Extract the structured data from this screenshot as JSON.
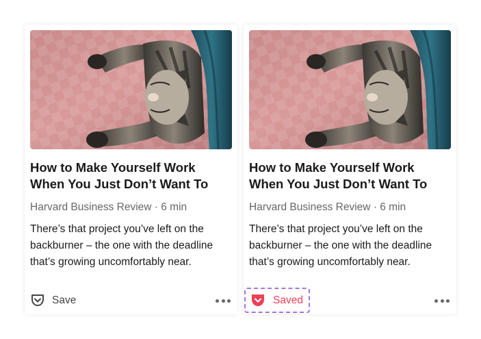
{
  "cards": [
    {
      "title_line1": "How to Make Yourself Work",
      "title_line2": "When You Just Don’t Want To",
      "publisher": "Harvard Business Review",
      "separator": " · ",
      "read_time": "6 min",
      "excerpt": "There’s that project you’ve left on the backburner – the one with the deadline that’s growing uncomfortably near.",
      "save_label": "Save",
      "save_state": "unsaved",
      "image_icon": "cat-photo"
    },
    {
      "title_line1": "How to Make Yourself Work",
      "title_line2": "When You Just Don’t Want To",
      "publisher": "Harvard Business Review",
      "separator": " · ",
      "read_time": "6 min",
      "excerpt": "There’s that project you’ve left on the backburner – the one with the deadline that’s growing uncomfortably near.",
      "save_label": "Saved",
      "save_state": "saved",
      "image_icon": "cat-photo"
    }
  ],
  "colors": {
    "accent_saved": "#ef4056",
    "focus_outline": "#a572e6",
    "text_primary": "#1a1a1a",
    "text_secondary": "#666666"
  },
  "icons": {
    "save": "pocket-outline-icon",
    "saved": "pocket-filled-icon",
    "more": "more-horizontal-icon"
  }
}
